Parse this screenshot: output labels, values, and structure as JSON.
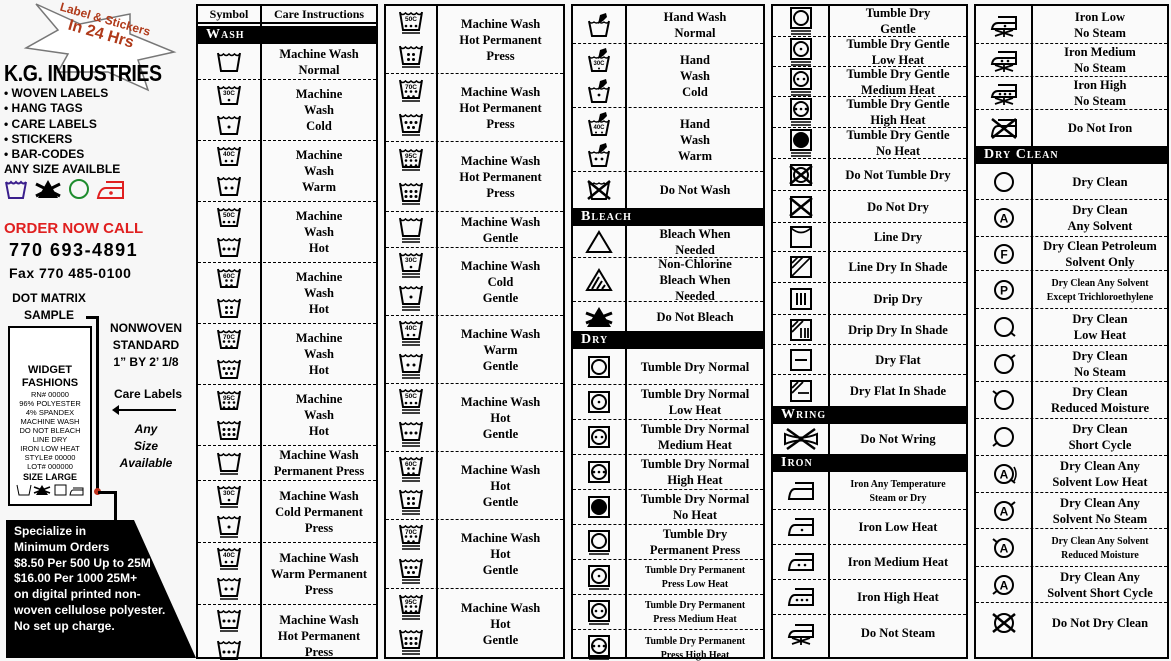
{
  "sidebar": {
    "star_line1": "Label & Stickers",
    "star_line2": "In 24 Hrs",
    "company": "K.G. INDUSTRIES",
    "services": [
      "• WOVEN  LABELS",
      "• HANG  TAGS",
      "• CARE  LABELS",
      "• STICKERS",
      "• BAR-CODES"
    ],
    "any_size": "ANY SIZE AVAILBLE",
    "logo_colors": {
      "wash": "#3a1e8c",
      "bleach": "#000000",
      "dryclean": "#1e8c2e",
      "iron": "#e02020"
    },
    "order_call": "ORDER NOW CALL",
    "phone": "770 693-4891",
    "fax": "Fax 770 485-0100",
    "dot_matrix": [
      "DOT MATRIX",
      "SAMPLE"
    ],
    "nonwoven": [
      "NONWOVEN",
      "STANDARD",
      "1” BY 2’ 1/8"
    ],
    "care_labels": "Care Labels",
    "any_size_available": [
      "Any",
      "Size",
      "Available"
    ],
    "sample_label": {
      "brand": [
        "WIDGET",
        "FASHIONS"
      ],
      "lines": [
        "RN# 00000",
        "96% POLYESTER",
        "4% SPANDEX",
        "MACHINE WASH",
        "DO NOT BLEACH",
        "LINE DRY",
        "IRON LOW HEAT",
        "STYLE# 00000",
        "LOT# 000000"
      ],
      "size": "SIZE LARGE"
    },
    "promo": [
      "Specialize in",
      "Minimum Orders",
      "$8.50 Per 500 Up to 25M",
      "$16.00 Per 1000 25M+",
      "on digital printed non-",
      "woven cellulose polyester.",
      "No set up charge."
    ]
  },
  "table": {
    "header_symbol": "Symbol",
    "header_care": "Care  Instructions",
    "sections": {
      "wash": "Wash",
      "bleach": "Bleach",
      "dry": "Dry",
      "wring": "Wring",
      "iron": "Iron",
      "dry_clean": "Dry Clean"
    },
    "col1": [
      {
        "icon": "tub",
        "text": "Machine Wash Normal"
      },
      {
        "icon": "tub-30c|tub-1dot",
        "text": "Machine\nWash\nCold"
      },
      {
        "icon": "tub-40c|tub-2dot",
        "text": "Machine\nWash\nWarm"
      },
      {
        "icon": "tub-50c|tub-3dot",
        "text": "Machine\nWash\nHot"
      },
      {
        "icon": "tub-60c|tub-4dot",
        "text": "Machine\nWash\nHot"
      },
      {
        "icon": "tub-70c|tub-5dot",
        "text": "Machine\nWash\nHot"
      },
      {
        "icon": "tub-95c|tub-6dot",
        "text": "Machine\nWash\nHot"
      },
      {
        "icon": "tub-pp",
        "text": "Machine Wash\nPermanent Press"
      },
      {
        "icon": "tub-30c-pp|tub-1dot-pp",
        "text": "Machine Wash\nCold Permanent\nPress"
      },
      {
        "icon": "tub-40c-pp|tub-2dot-pp",
        "text": "Machine Wash\nWarm Permanent\nPress"
      },
      {
        "icon": "tub-3dot-pp|tub-3dot-pp",
        "text": "Machine Wash\nHot Permanent\nPress"
      }
    ],
    "col2": [
      {
        "icon": "tub-50c-pp|tub-4dot-pp",
        "text": "Machine Wash\nHot Permanent\nPress"
      },
      {
        "icon": "tub-70c-pp|tub-5dot-pp",
        "text": "Machine Wash\nHot Permanent\nPress"
      },
      {
        "icon": "tub-95c-pp|tub-6dot-pp",
        "text": "Machine Wash\nHot Permanent\nPress"
      },
      {
        "icon": "tub-gentle",
        "text": "Machine Wash\nGentle"
      },
      {
        "icon": "tub-30c-gentle|tub-1dot-gentle",
        "text": "Machine Wash\nCold\nGentle"
      },
      {
        "icon": "tub-40c-gentle|tub-2dot-gentle",
        "text": "Machine Wash\nWarm\nGentle"
      },
      {
        "icon": "tub-50c-gentle|tub-3dot-gentle",
        "text": "Machine Wash\nHot\nGentle"
      },
      {
        "icon": "tub-60c-gentle|tub-4dot-gentle",
        "text": "Machine Wash\nHot\nGentle"
      },
      {
        "icon": "tub-70c-gentle|tub-5dot-gentle",
        "text": "Machine Wash\nHot\nGentle"
      },
      {
        "icon": "tub-95c-gentle|tub-6dot-gentle",
        "text": "Machine Wash\nHot\nGentle"
      }
    ],
    "col3_wash": [
      {
        "icon": "hand-wash",
        "text": "Hand Wash\nNormal"
      },
      {
        "icon": "hand-wash-30c|hand-wash-1dot",
        "text": "Hand\nWash\nCold"
      },
      {
        "icon": "hand-wash-40c|hand-wash-2dot",
        "text": "Hand\nWash\nWarm"
      },
      {
        "icon": "do-not-wash",
        "text": "Do Not Wash"
      }
    ],
    "col3_bleach": [
      {
        "icon": "triangle",
        "text": "Bleach When\nNeeded"
      },
      {
        "icon": "triangle-striped",
        "text": "Non-Chlorine\nBleach When\nNeeded"
      },
      {
        "icon": "do-not-bleach",
        "text": "Do Not Bleach"
      }
    ],
    "col3_dry": [
      {
        "icon": "tumble",
        "text": "Tumble Dry Normal"
      },
      {
        "icon": "tumble-1dot",
        "text": "Tumble Dry Normal\nLow Heat"
      },
      {
        "icon": "tumble-2dot",
        "text": "Tumble Dry Normal\nMedium Heat"
      },
      {
        "icon": "tumble-3dot",
        "text": "Tumble Dry Normal\nHigh Heat"
      },
      {
        "icon": "tumble-filled",
        "text": "Tumble Dry Normal\nNo Heat"
      },
      {
        "icon": "tumble-pp",
        "text": "Tumble Dry\nPermanent Press"
      },
      {
        "icon": "tumble-1dot-pp",
        "text": "Tumble Dry Permanent\nPress Low Heat"
      },
      {
        "icon": "tumble-2dot-pp",
        "text": "Tumble Dry Permanent\nPress Medium Heat"
      },
      {
        "icon": "tumble-3dot-pp",
        "text": "Tumble Dry Permanent\nPress High Heat"
      }
    ],
    "col4_dry": [
      {
        "icon": "tumble-gentle",
        "text": "Tumble Dry\nGentle"
      },
      {
        "icon": "tumble-1dot-gentle",
        "text": "Tumble Dry Gentle\nLow Heat"
      },
      {
        "icon": "tumble-2dot-gentle",
        "text": "Tumble Dry Gentle\nMedium Heat"
      },
      {
        "icon": "tumble-3dot-gentle",
        "text": "Tumble Dry Gentle\nHigh Heat"
      },
      {
        "icon": "tumble-filled-gentle",
        "text": "Tumble Dry Gentle\nNo Heat"
      },
      {
        "icon": "do-not-tumble",
        "text": "Do Not Tumble Dry"
      },
      {
        "icon": "do-not-dry",
        "text": "Do Not Dry"
      },
      {
        "icon": "line-dry",
        "text": "Line Dry"
      },
      {
        "icon": "line-dry-shade",
        "text": "Line Dry In Shade"
      },
      {
        "icon": "drip-dry",
        "text": "Drip Dry"
      },
      {
        "icon": "drip-dry-shade",
        "text": "Drip Dry In Shade"
      },
      {
        "icon": "dry-flat",
        "text": "Dry Flat"
      },
      {
        "icon": "dry-flat-shade",
        "text": "Dry Flat In Shade"
      }
    ],
    "col4_wring": [
      {
        "icon": "do-not-wring",
        "text": "Do Not Wring"
      }
    ],
    "col4_iron": [
      {
        "icon": "iron",
        "text": "Iron Any Temperature\nSteam or Dry"
      },
      {
        "icon": "iron-1dot",
        "text": "Iron Low Heat"
      },
      {
        "icon": "iron-2dot",
        "text": "Iron Medium Heat"
      },
      {
        "icon": "iron-3dot",
        "text": "Iron High Heat"
      },
      {
        "icon": "iron-no-steam",
        "text": "Do Not Steam"
      }
    ],
    "col5_iron": [
      {
        "icon": "iron-no-steam-1dot",
        "text": "Iron Low\nNo Steam"
      },
      {
        "icon": "iron-no-steam-2dot",
        "text": "Iron Medium\nNo Steam"
      },
      {
        "icon": "iron-no-steam-3dot",
        "text": "Iron High\nNo Steam"
      },
      {
        "icon": "do-not-iron",
        "text": "Do Not Iron"
      }
    ],
    "col5_dryclean": [
      {
        "icon": "circle",
        "text": "Dry Clean"
      },
      {
        "icon": "circle-A",
        "text": "Dry Clean\nAny Solvent"
      },
      {
        "icon": "circle-F",
        "text": "Dry Clean Petroleum\nSolvent Only"
      },
      {
        "icon": "circle-P",
        "text": "Dry Clean Any Solvent\nExcept Trichloroethylene"
      },
      {
        "icon": "circle-low-heat",
        "text": "Dry Clean\nLow Heat"
      },
      {
        "icon": "circle-no-steam",
        "text": "Dry Clean\nNo Steam"
      },
      {
        "icon": "circle-reduced-moisture",
        "text": "Dry Clean\nReduced Moisture"
      },
      {
        "icon": "circle-short-cycle",
        "text": "Dry Clean\nShort Cycle"
      },
      {
        "icon": "circle-A-low-heat",
        "text": "Dry Clean Any\nSolvent Low Heat"
      },
      {
        "icon": "circle-A-no-steam",
        "text": "Dry Clean Any\nSolvent No Steam"
      },
      {
        "icon": "circle-A-reduced-moisture",
        "text": "Dry Clean Any Solvent\nReduced Moisture"
      },
      {
        "icon": "circle-A-short-cycle",
        "text": "Dry Clean Any\nSolvent Short Cycle"
      },
      {
        "icon": "do-not-dry-clean",
        "text": "Do Not Dry Clean"
      }
    ]
  }
}
